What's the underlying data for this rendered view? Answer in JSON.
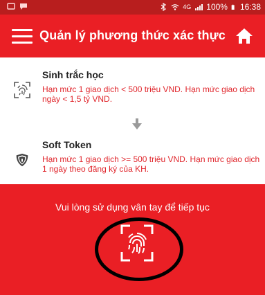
{
  "status_bar": {
    "battery": "100%",
    "time": "16:38",
    "network": "4G",
    "icons": [
      "notification-icon",
      "message-icon",
      "bluetooth-icon",
      "wifi-icon",
      "signal-icon",
      "battery-icon"
    ]
  },
  "app_bar": {
    "title": "Quản lý phương thức xác thực",
    "menu_icon": "hamburger-menu-icon",
    "home_icon": "home-icon"
  },
  "methods": [
    {
      "name": "Sinh trắc học",
      "description": "Hạn mức 1 giao dịch < 500 triệu VND. Hạn mức giao dịch ngày < 1,5 tỷ VND.",
      "icon": "fingerprint-scan-icon"
    },
    {
      "name": "Soft Token",
      "description": "Hạn mức 1 giao dịch >= 500 triệu VND. Hạn mức giao dịch 1 ngày theo đăng ký của KH.",
      "icon": "shield-icon"
    }
  ],
  "biometric_prompt": {
    "message": "Vui lòng sử dụng vân tay để tiếp tục",
    "icon": "fingerprint-scan-icon"
  },
  "colors": {
    "brand_red": "#ea1f25",
    "status_bar": "#b81e1e",
    "limit_text": "#e0252b"
  }
}
